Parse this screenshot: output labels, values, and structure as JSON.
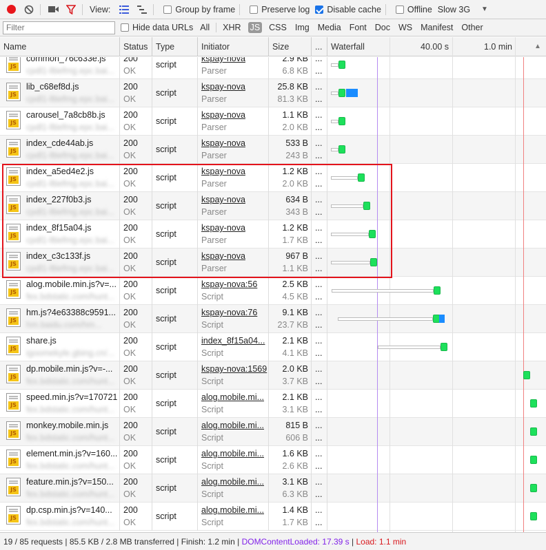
{
  "toolbar": {
    "view_label": "View:",
    "group_by_frame": "Group by frame",
    "preserve_log": "Preserve log",
    "disable_cache": "Disable cache",
    "offline": "Offline",
    "throttle": "Slow 3G",
    "record_color": "#e8161c",
    "filter_active_color": "#d8171d"
  },
  "filter": {
    "placeholder": "Filter",
    "hide_data_urls": "Hide data URLs",
    "types": [
      "All",
      "XHR",
      "JS",
      "CSS",
      "Img",
      "Media",
      "Font",
      "Doc",
      "WS",
      "Manifest",
      "Other"
    ],
    "active_type": "JS"
  },
  "columns": {
    "name": "Name",
    "status": "Status",
    "type": "Type",
    "initiator": "Initiator",
    "size": "Size",
    "more": "...",
    "waterfall": "Waterfall",
    "t40": "40.00 s",
    "t1m": "1.0 min",
    "sort": "▲"
  },
  "rows": [
    {
      "name": "common_76c633e.js",
      "url": "cpdl1-lltiefmg.epc.bai...",
      "status": "200",
      "status_text": "OK",
      "type": "script",
      "initiator": "kspay-nova",
      "initiator_type": "Parser",
      "size": "2.9 KB",
      "resource": "6.8 KB"
    },
    {
      "name": "lib_c68ef8d.js",
      "url": "cpdl1-lltiefmg.epc.bai...",
      "status": "200",
      "status_text": "OK",
      "type": "script",
      "initiator": "kspay-nova",
      "initiator_type": "Parser",
      "size": "25.8 KB",
      "resource": "81.3 KB"
    },
    {
      "name": "carousel_7a8cb8b.js",
      "url": "cpdl1-lltiefmg.epc.bai...",
      "status": "200",
      "status_text": "OK",
      "type": "script",
      "initiator": "kspay-nova",
      "initiator_type": "Parser",
      "size": "1.1 KB",
      "resource": "2.0 KB"
    },
    {
      "name": "index_cde44ab.js",
      "url": "cpdl1-lltiefmg.epc.bai...",
      "status": "200",
      "status_text": "OK",
      "type": "script",
      "initiator": "kspay-nova",
      "initiator_type": "Parser",
      "size": "533 B",
      "resource": "243 B"
    },
    {
      "name": "index_a5ed4e2.js",
      "url": "cpdl1-lltiefmg.epc.bai...",
      "status": "200",
      "status_text": "OK",
      "type": "script",
      "initiator": "kspay-nova",
      "initiator_type": "Parser",
      "size": "1.2 KB",
      "resource": "2.0 KB"
    },
    {
      "name": "index_227f0b3.js",
      "url": "cpdl1-lltiefmg.epc.bai...",
      "status": "200",
      "status_text": "OK",
      "type": "script",
      "initiator": "kspay-nova",
      "initiator_type": "Parser",
      "size": "634 B",
      "resource": "343 B"
    },
    {
      "name": "index_8f15a04.js",
      "url": "cpdl1-lltiefmg.epc.bai...",
      "status": "200",
      "status_text": "OK",
      "type": "script",
      "initiator": "kspay-nova",
      "initiator_type": "Parser",
      "size": "1.2 KB",
      "resource": "1.7 KB"
    },
    {
      "name": "index_c3c133f.js",
      "url": "cpdl1-lltiefmg.epc.bai...",
      "status": "200",
      "status_text": "OK",
      "type": "script",
      "initiator": "kspay-nova",
      "initiator_type": "Parser",
      "size": "967 B",
      "resource": "1.1 KB"
    },
    {
      "name": "alog.mobile.min.js?v=...",
      "url": "fex.bdstatic.com/hunt...",
      "status": "200",
      "status_text": "OK",
      "type": "script",
      "initiator": "kspay-nova:56",
      "initiator_type": "Script",
      "size": "2.5 KB",
      "resource": "4.5 KB"
    },
    {
      "name": "hm.js?4e63388c9591...",
      "url": "hm.baidu.com/hm...",
      "status": "200",
      "status_text": "OK",
      "type": "script",
      "initiator": "kspay-nova:76",
      "initiator_type": "Script",
      "size": "9.1 KB",
      "resource": "23.7 KB"
    },
    {
      "name": "share.js",
      "url": "igoomekyle.gbing.cn/...",
      "status": "200",
      "status_text": "OK",
      "type": "script",
      "initiator": "index_8f15a04...",
      "initiator_type": "Script",
      "size": "2.1 KB",
      "resource": "4.1 KB"
    },
    {
      "name": "dp.mobile.min.js?v=-...",
      "url": "fex.bdstatic.com/hunt...",
      "status": "200",
      "status_text": "OK",
      "type": "script",
      "initiator": "kspay-nova:1569",
      "initiator_type": "Script",
      "size": "2.0 KB",
      "resource": "3.7 KB"
    },
    {
      "name": "speed.min.js?v=170721",
      "url": "fex.bdstatic.com/hunt...",
      "status": "200",
      "status_text": "OK",
      "type": "script",
      "initiator": "alog.mobile.mi...",
      "initiator_type": "Script",
      "size": "2.1 KB",
      "resource": "3.1 KB"
    },
    {
      "name": "monkey.mobile.min.js",
      "url": "fex.bdstatic.com/hunt...",
      "status": "200",
      "status_text": "OK",
      "type": "script",
      "initiator": "alog.mobile.mi...",
      "initiator_type": "Script",
      "size": "815 B",
      "resource": "606 B"
    },
    {
      "name": "element.min.js?v=160...",
      "url": "fex.bdstatic.com/hunt...",
      "status": "200",
      "status_text": "OK",
      "type": "script",
      "initiator": "alog.mobile.mi...",
      "initiator_type": "Script",
      "size": "1.6 KB",
      "resource": "2.6 KB"
    },
    {
      "name": "feature.min.js?v=150...",
      "url": "fex.bdstatic.com/hunt...",
      "status": "200",
      "status_text": "OK",
      "type": "script",
      "initiator": "alog.mobile.mi...",
      "initiator_type": "Script",
      "size": "3.1 KB",
      "resource": "6.3 KB"
    },
    {
      "name": "dp.csp.min.js?v=140...",
      "url": "fex.bdstatic.com/hunt...",
      "status": "200",
      "status_text": "OK",
      "type": "script",
      "initiator": "alog.mobile.mi...",
      "initiator_type": "Script",
      "size": "1.4 KB",
      "resource": "1.7 KB"
    }
  ],
  "status_bar": {
    "requests": "19 / 85 requests",
    "transferred": "85.5 KB / 2.8 MB transferred",
    "finish": "Finish: 1.2 min",
    "dom_content_loaded": "DOMContentLoaded: 17.39 s",
    "load": "Load: 1.1 min",
    "dcl_color": "#8122e8",
    "load_color": "#d8171d"
  }
}
